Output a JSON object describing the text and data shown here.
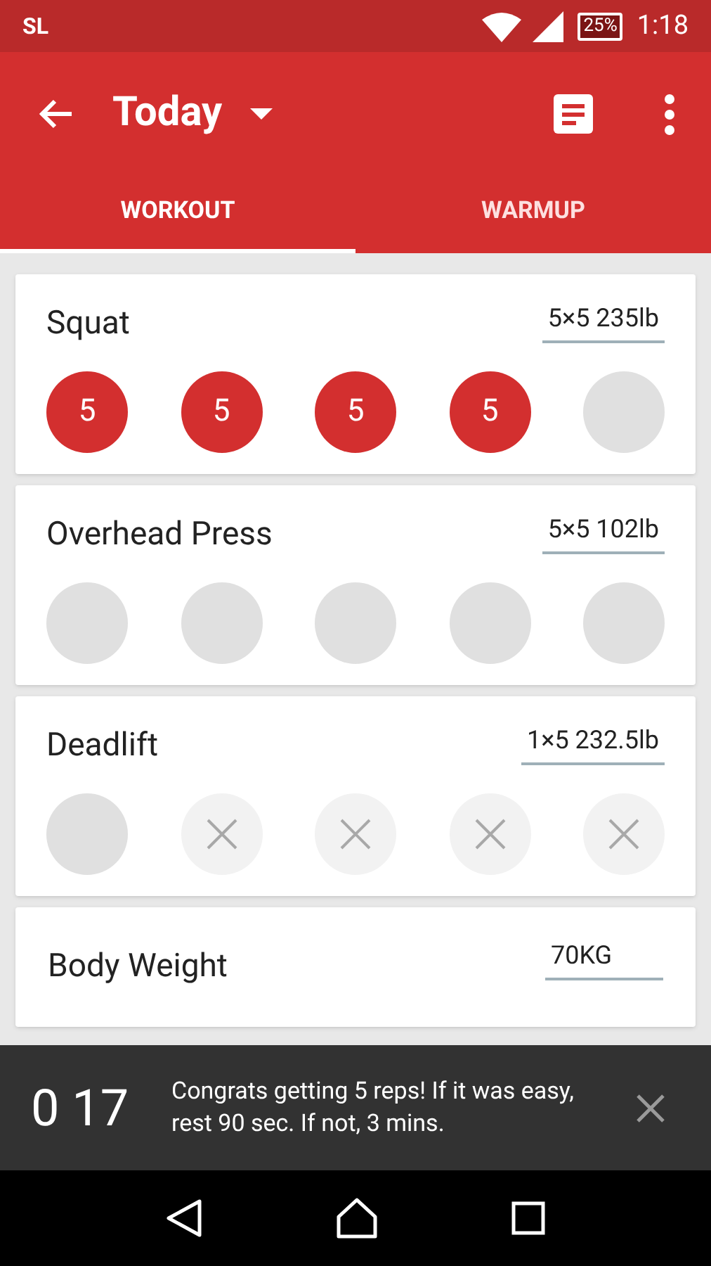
{
  "status_bar": {
    "carrier": "SL",
    "battery": "25%",
    "time": "1:18"
  },
  "toolbar": {
    "title": "Today"
  },
  "tabs": [
    {
      "label": "WORKOUT",
      "selected": true
    },
    {
      "label": "WARMUP",
      "selected": false
    }
  ],
  "exercises": [
    {
      "name": "Squat",
      "weight": "5×5 235lb",
      "sets": [
        {
          "kind": "done",
          "reps": "5"
        },
        {
          "kind": "done",
          "reps": "5"
        },
        {
          "kind": "done",
          "reps": "5"
        },
        {
          "kind": "done",
          "reps": "5"
        },
        {
          "kind": "empty"
        }
      ]
    },
    {
      "name": "Overhead Press",
      "weight": "5×5 102lb",
      "sets": [
        {
          "kind": "empty"
        },
        {
          "kind": "empty"
        },
        {
          "kind": "empty"
        },
        {
          "kind": "empty"
        },
        {
          "kind": "empty"
        }
      ]
    },
    {
      "name": "Deadlift",
      "weight": "1×5 232.5lb",
      "sets": [
        {
          "kind": "empty"
        },
        {
          "kind": "unused"
        },
        {
          "kind": "unused"
        },
        {
          "kind": "unused"
        },
        {
          "kind": "unused"
        }
      ]
    }
  ],
  "body_weight": {
    "label": "Body Weight",
    "value": "70KG"
  },
  "snackbar": {
    "timer": "0 17",
    "message": "Congrats getting 5 reps! If it was easy, rest 90 sec. If not, 3 mins."
  }
}
